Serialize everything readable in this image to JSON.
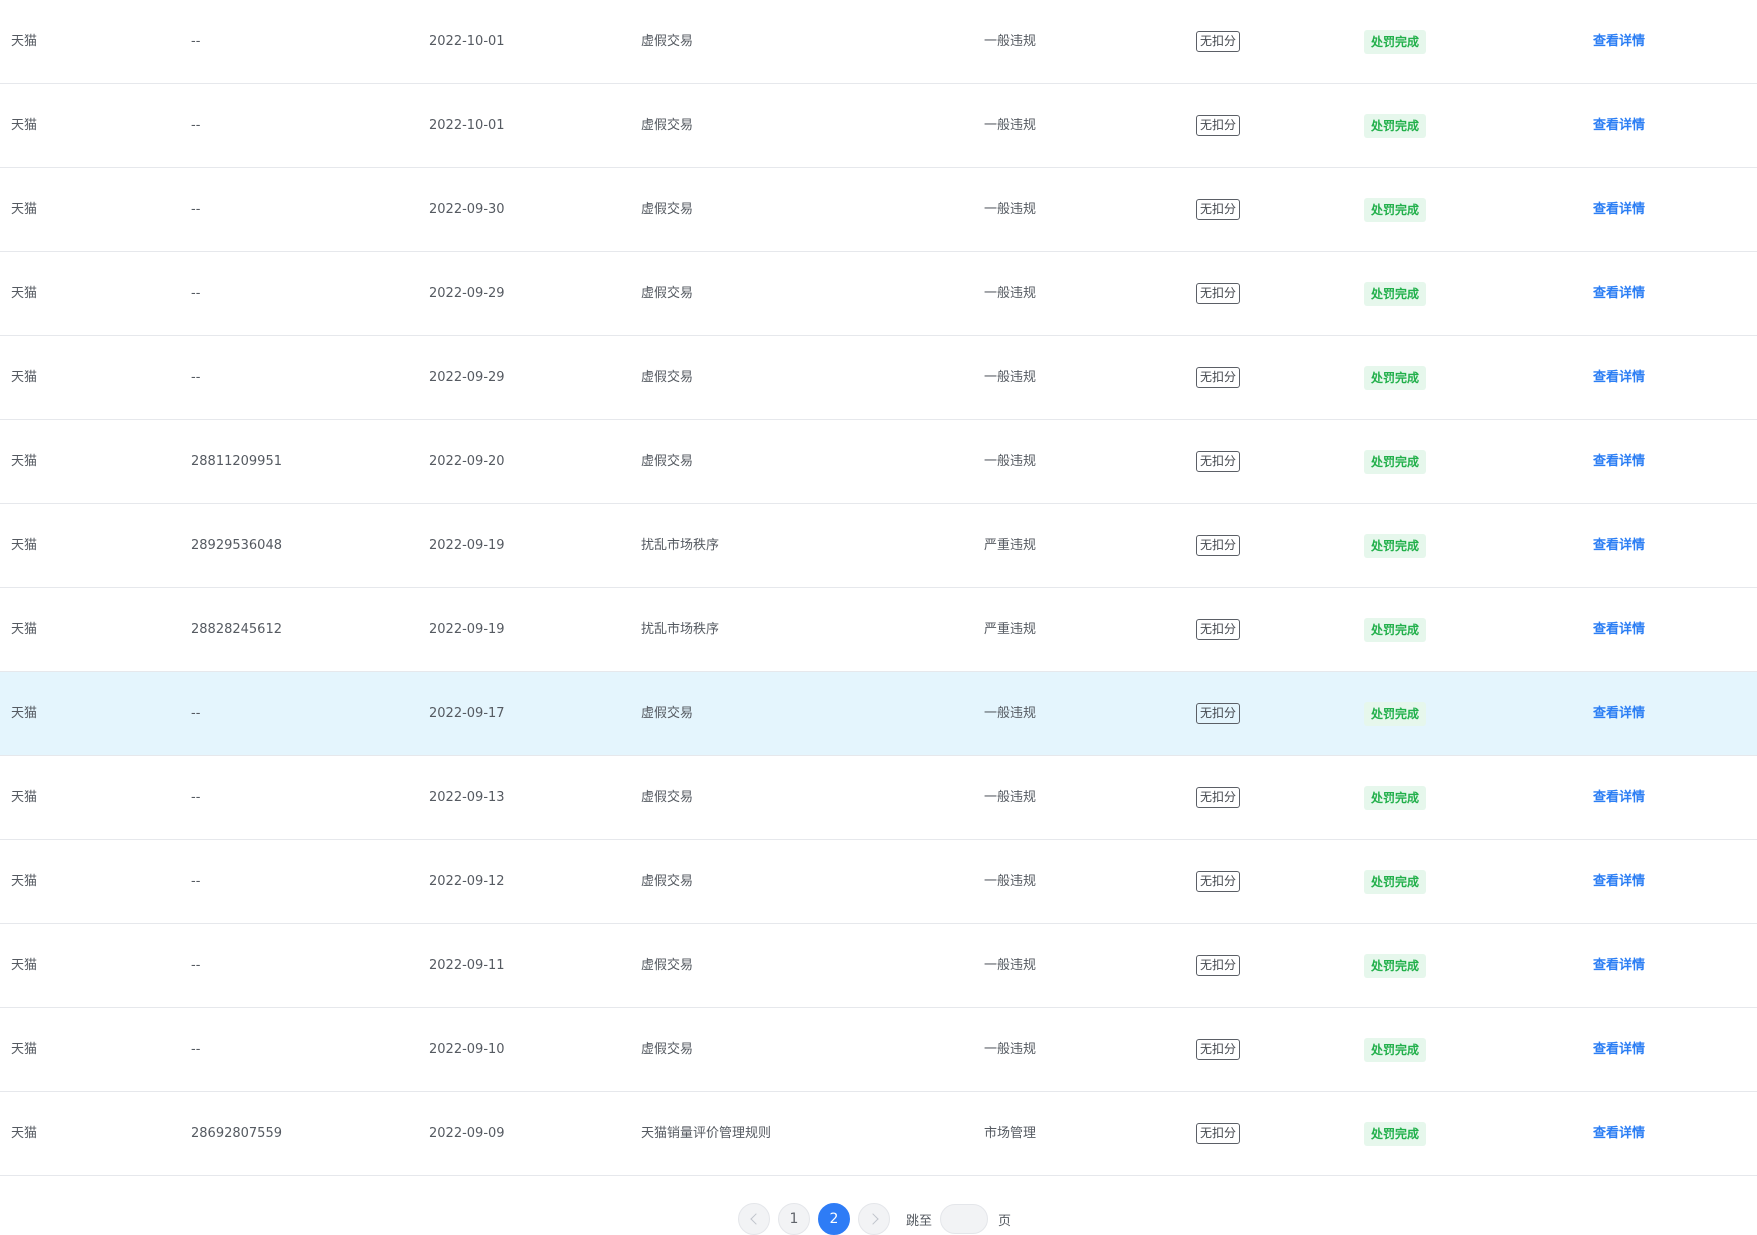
{
  "table": {
    "rows": [
      {
        "platform": "天猫",
        "id": "--",
        "date": "2022-10-01",
        "type": "虚假交易",
        "level": "一般违规",
        "score": "无扣分",
        "status": "处罚完成",
        "action": "查看详情"
      },
      {
        "platform": "天猫",
        "id": "--",
        "date": "2022-10-01",
        "type": "虚假交易",
        "level": "一般违规",
        "score": "无扣分",
        "status": "处罚完成",
        "action": "查看详情"
      },
      {
        "platform": "天猫",
        "id": "--",
        "date": "2022-09-30",
        "type": "虚假交易",
        "level": "一般违规",
        "score": "无扣分",
        "status": "处罚完成",
        "action": "查看详情"
      },
      {
        "platform": "天猫",
        "id": "--",
        "date": "2022-09-29",
        "type": "虚假交易",
        "level": "一般违规",
        "score": "无扣分",
        "status": "处罚完成",
        "action": "查看详情"
      },
      {
        "platform": "天猫",
        "id": "--",
        "date": "2022-09-29",
        "type": "虚假交易",
        "level": "一般违规",
        "score": "无扣分",
        "status": "处罚完成",
        "action": "查看详情"
      },
      {
        "platform": "天猫",
        "id": "28811209951",
        "date": "2022-09-20",
        "type": "虚假交易",
        "level": "一般违规",
        "score": "无扣分",
        "status": "处罚完成",
        "action": "查看详情"
      },
      {
        "platform": "天猫",
        "id": "28929536048",
        "date": "2022-09-19",
        "type": "扰乱市场秩序",
        "level": "严重违规",
        "score": "无扣分",
        "status": "处罚完成",
        "action": "查看详情"
      },
      {
        "platform": "天猫",
        "id": "28828245612",
        "date": "2022-09-19",
        "type": "扰乱市场秩序",
        "level": "严重违规",
        "score": "无扣分",
        "status": "处罚完成",
        "action": "查看详情"
      },
      {
        "platform": "天猫",
        "id": "--",
        "date": "2022-09-17",
        "type": "虚假交易",
        "level": "一般违规",
        "score": "无扣分",
        "status": "处罚完成",
        "action": "查看详情",
        "highlighted": true
      },
      {
        "platform": "天猫",
        "id": "--",
        "date": "2022-09-13",
        "type": "虚假交易",
        "level": "一般违规",
        "score": "无扣分",
        "status": "处罚完成",
        "action": "查看详情"
      },
      {
        "platform": "天猫",
        "id": "--",
        "date": "2022-09-12",
        "type": "虚假交易",
        "level": "一般违规",
        "score": "无扣分",
        "status": "处罚完成",
        "action": "查看详情"
      },
      {
        "platform": "天猫",
        "id": "--",
        "date": "2022-09-11",
        "type": "虚假交易",
        "level": "一般违规",
        "score": "无扣分",
        "status": "处罚完成",
        "action": "查看详情"
      },
      {
        "platform": "天猫",
        "id": "--",
        "date": "2022-09-10",
        "type": "虚假交易",
        "level": "一般违规",
        "score": "无扣分",
        "status": "处罚完成",
        "action": "查看详情"
      },
      {
        "platform": "天猫",
        "id": "28692807559",
        "date": "2022-09-09",
        "type": "天猫销量评价管理规则",
        "level": "市场管理",
        "score": "无扣分",
        "status": "处罚完成",
        "action": "查看详情"
      }
    ]
  },
  "pagination": {
    "prev_icon": "chevron-left-icon",
    "next_icon": "chevron-right-icon",
    "pages": [
      "1",
      "2"
    ],
    "current_page": "2",
    "jump_label": "跳至",
    "jump_value": "",
    "page_unit": "页"
  },
  "colors": {
    "link": "#2b7ef4",
    "status_text": "#22b04b",
    "status_bg": "#e6f7ec",
    "highlight_row": "#e4f5fd",
    "active_page": "#2e7cf6"
  }
}
